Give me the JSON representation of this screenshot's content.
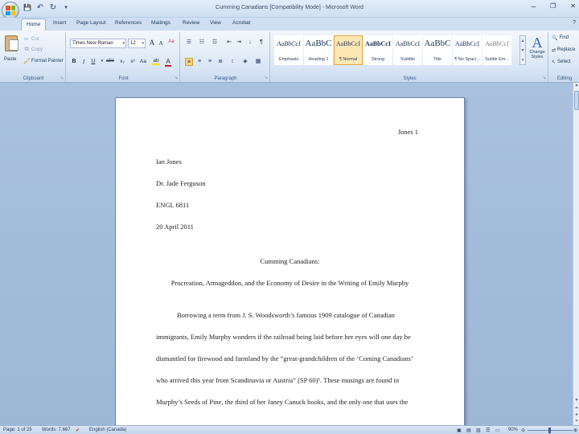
{
  "window": {
    "title": "Cumming Canadians [Compatibility Mode] - Microsoft Word",
    "minimize": "–",
    "restore": "❐",
    "close": "✕"
  },
  "quick_access": {
    "save": "💾",
    "undo": "↶",
    "redo": "↻",
    "customize": "▾"
  },
  "tabs": [
    "Home",
    "Insert",
    "Page Layout",
    "References",
    "Mailings",
    "Review",
    "View",
    "Acrobat"
  ],
  "help": "?",
  "clipboard": {
    "paste": "Paste",
    "cut": "Cut",
    "copy": "Copy",
    "format_painter": "Format Painter",
    "label": "Clipboard"
  },
  "font": {
    "name": "Times New Roman",
    "size": "12",
    "grow": "A",
    "shrink": "A",
    "clear": "Aa",
    "bold": "B",
    "italic": "I",
    "underline": "U",
    "strike": "abe",
    "subscript": "x₂",
    "superscript": "x²",
    "case": "Aa",
    "highlight": "ab",
    "color": "A",
    "label": "Font",
    "highlight_color": "#f5e600",
    "font_color": "#d11f1f"
  },
  "paragraph": {
    "label": "Paragraph",
    "sort": "↓",
    "pilcrow": "¶"
  },
  "styles": {
    "items": [
      {
        "sample": "AaBbCcI",
        "name": "Emphasis"
      },
      {
        "sample": "AaBbC",
        "name": "Heading 1"
      },
      {
        "sample": "AaBbCcI",
        "name": "¶ Normal"
      },
      {
        "sample": "AaBbCcI",
        "name": "Strong"
      },
      {
        "sample": "AaBbCcI",
        "name": "Subtitle"
      },
      {
        "sample": "AaBbC",
        "name": "Title"
      },
      {
        "sample": "AaBbCcI",
        "name": "¶ No Spaci..."
      },
      {
        "sample": "AaBbCcI",
        "name": "Subtle Em..."
      }
    ],
    "change_styles": "Change Styles",
    "label": "Styles"
  },
  "editing": {
    "find": "Find",
    "replace": "Replace",
    "select": "Select",
    "label": "Editing"
  },
  "document": {
    "header": "Jones 1",
    "author": "Ian Jones",
    "instructor": "Dr. Jade Ferguson",
    "course": "ENGL 6811",
    "date": "20 April 2011",
    "title": "Cumming Canadians:",
    "subtitle": "Procreation, Armageddon, and the Economy of Desire in the Writing of Emily Murphy",
    "body": [
      "Borrowing a term from J. S. Woodsworth’s famous 1909 catalogue of Canadian",
      "immigrants, Emily Murphy wonders if the railroad being laid before her eyes will one day be",
      "dismantled for firewood and farmland by the “great-grandchildren of the ‘Coming Canadians’",
      "who arrived this year from Scandinavia or Austria” (SP 60)¹. These musings are found in",
      "Murphy’s Seeds of Pine, the third of her Janey Canuck books, and the only one that uses the"
    ]
  },
  "status": {
    "page": "Page: 1 of 25",
    "words": "Words: 7,667",
    "language": "English (Canada)",
    "zoom": "90%"
  }
}
